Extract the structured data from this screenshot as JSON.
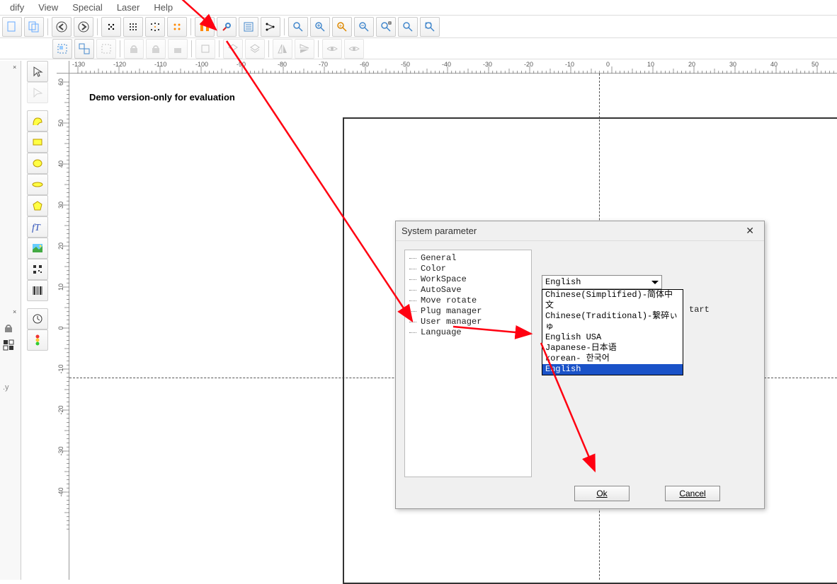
{
  "menu": {
    "items": [
      "dify",
      "View",
      "Special",
      "Laser",
      "Help"
    ]
  },
  "canvas": {
    "watermark": "Demo version-only for evaluation"
  },
  "ruler_h": [
    "-130",
    "-120",
    "-110",
    "-100",
    "-90",
    "-80",
    "-70",
    "-60",
    "-50",
    "-40",
    "-30",
    "-20",
    "-10",
    "0",
    "10",
    "20",
    "30",
    "40",
    "50"
  ],
  "ruler_v": [
    "60",
    "50",
    "40",
    "30",
    "20",
    "10",
    "0",
    "-10",
    "-20",
    "-30",
    "-40"
  ],
  "dialog": {
    "title": "System parameter",
    "tree": [
      "General",
      "Color",
      "WorkSpace",
      "AutoSave",
      "Move rotate",
      "Plug manager",
      "User manager",
      "Language"
    ],
    "combo_value": "English",
    "options": [
      "Chinese(Simplified)-简体中文",
      "Chinese(Traditional)-繫碎ぃゅ",
      "English USA",
      "Japanese-日本语",
      "korean- 한국어",
      "English"
    ],
    "selected_index": 5,
    "restart_hint": "tart",
    "ok": "Ok",
    "cancel": "Cancel"
  }
}
